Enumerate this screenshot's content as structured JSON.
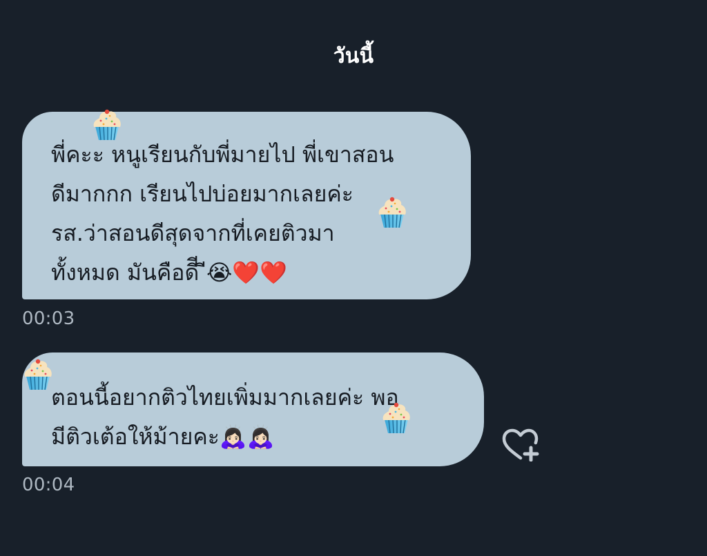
{
  "date_header": "วันนี้",
  "messages": [
    {
      "text": "พี่คะะ หนูเรียนกับพี่มายไป พี่เขาสอน\nดีมากกก เรียนไปบ่อยมากเลยค่ะ\nรส.ว่าสอนดีสุดจากที่เคยติวมา\nทั้งหมด มันคือดีี ี😭❤️❤️",
      "time": "00:03"
    },
    {
      "text": "ตอนนี้อยากติวไทยเพิ่มมากเลยค่ะ พอ\nมีติวเต้อให้ม้ายคะ🙇🏻‍♀️🙇🏻‍♀️",
      "time": "00:04"
    }
  ],
  "icons": {
    "decoration": "cupcake-icon",
    "reaction": "heart-plus-icon"
  },
  "colors": {
    "background": "#18202a",
    "bubble": "#b8ccd9",
    "bubble_text": "#161b22",
    "timestamp": "#aeb8c2",
    "header_text": "#ffffff",
    "icon": "#c4ccd4"
  }
}
